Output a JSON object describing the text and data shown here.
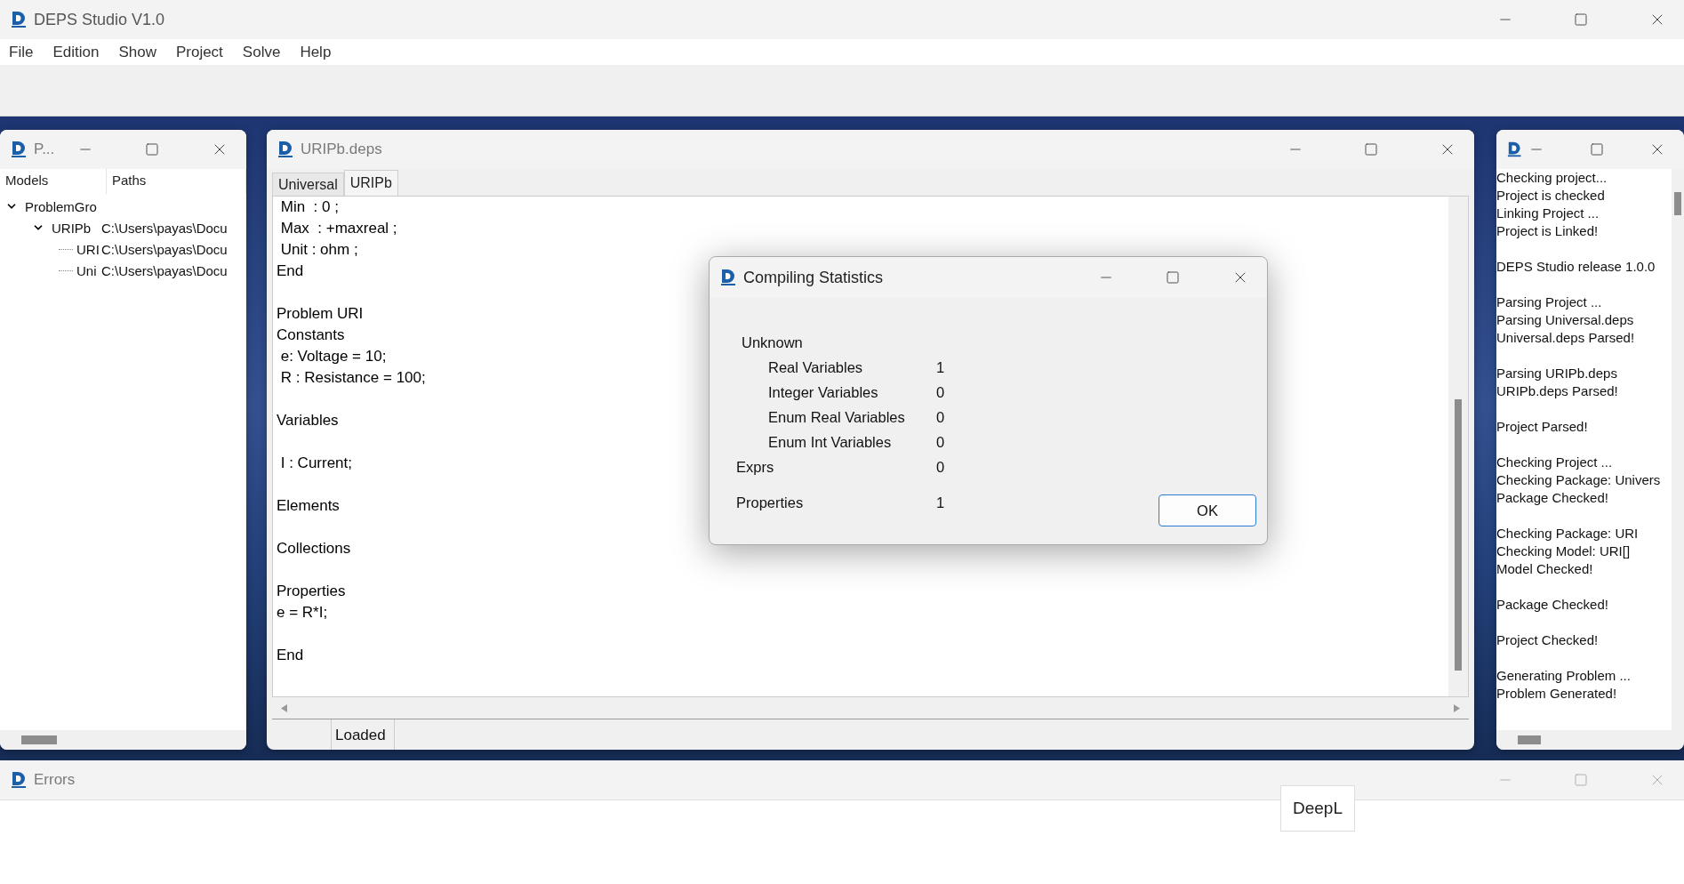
{
  "app": {
    "title": "DEPS Studio V1.0",
    "menu": [
      "File",
      "Edition",
      "Show",
      "Project",
      "Solve",
      "Help"
    ]
  },
  "project_panel": {
    "title": "P...",
    "columns": [
      "Models",
      "Paths"
    ],
    "tree": [
      {
        "label": "ProblemGro",
        "expanded": true,
        "children": [
          {
            "label": "URIPb",
            "path": "C:\\Users\\payas\\Docu",
            "expanded": true,
            "children": [
              {
                "label": "URI",
                "path": "C:\\Users\\payas\\Docu"
              },
              {
                "label": "Uni",
                "path": "C:\\Users\\payas\\Docu"
              }
            ]
          }
        ]
      }
    ]
  },
  "editor": {
    "title": "URIPb.deps",
    "tabs": [
      {
        "label": "Universal",
        "selected": false
      },
      {
        "label": "URIPb",
        "selected": true
      }
    ],
    "paragraphs": [
      [
        " Min  : 0 ;",
        " Max  : +maxreal ;",
        " Unit : ohm ;",
        "End"
      ],
      [
        "Problem URI",
        "Constants",
        " e: Voltage = 10;",
        " R : Resistance = 100;"
      ],
      [
        "Variables"
      ],
      [
        " I : Current;"
      ],
      [
        "Elements"
      ],
      [
        "Collections"
      ],
      [
        "Properties",
        "e = R*I;"
      ],
      [
        "End"
      ]
    ],
    "status": "Loaded"
  },
  "log_panel": {
    "paragraphs": [
      [
        "Checking project...",
        "Project is checked",
        "Linking Project ...",
        "Project is Linked!"
      ],
      [
        "DEPS Studio release 1.0.0"
      ],
      [
        "Parsing Project ...",
        "Parsing Universal.deps",
        "Universal.deps Parsed!"
      ],
      [
        "Parsing URIPb.deps",
        "URIPb.deps Parsed!"
      ],
      [
        "Project Parsed!"
      ],
      [
        "Checking Project ...",
        "Checking Package: Univers",
        "Package Checked!"
      ],
      [
        "Checking Package: URI",
        "Checking Model: URI[]",
        "Model Checked!"
      ],
      [
        "Package Checked!"
      ],
      [
        "Project Checked!"
      ],
      [
        "Generating Problem ...",
        "Problem Generated!"
      ]
    ]
  },
  "dialog": {
    "title": "Compiling Statistics",
    "rows": [
      {
        "kind": "group",
        "label": "Unknown",
        "children": [
          {
            "label": "Real Variables",
            "value": "1"
          },
          {
            "label": "Integer Variables",
            "value": "0"
          },
          {
            "label": "Enum Real Variables",
            "value": "0"
          },
          {
            "label": "Enum Int Variables",
            "value": "0"
          }
        ]
      },
      {
        "kind": "stat",
        "label": "Exprs",
        "value": "0"
      },
      {
        "kind": "stat",
        "label": "Properties",
        "value": "1"
      }
    ],
    "button": "OK"
  },
  "errors_window": {
    "title": "Errors"
  },
  "tooltip": {
    "text": "DeepL"
  }
}
